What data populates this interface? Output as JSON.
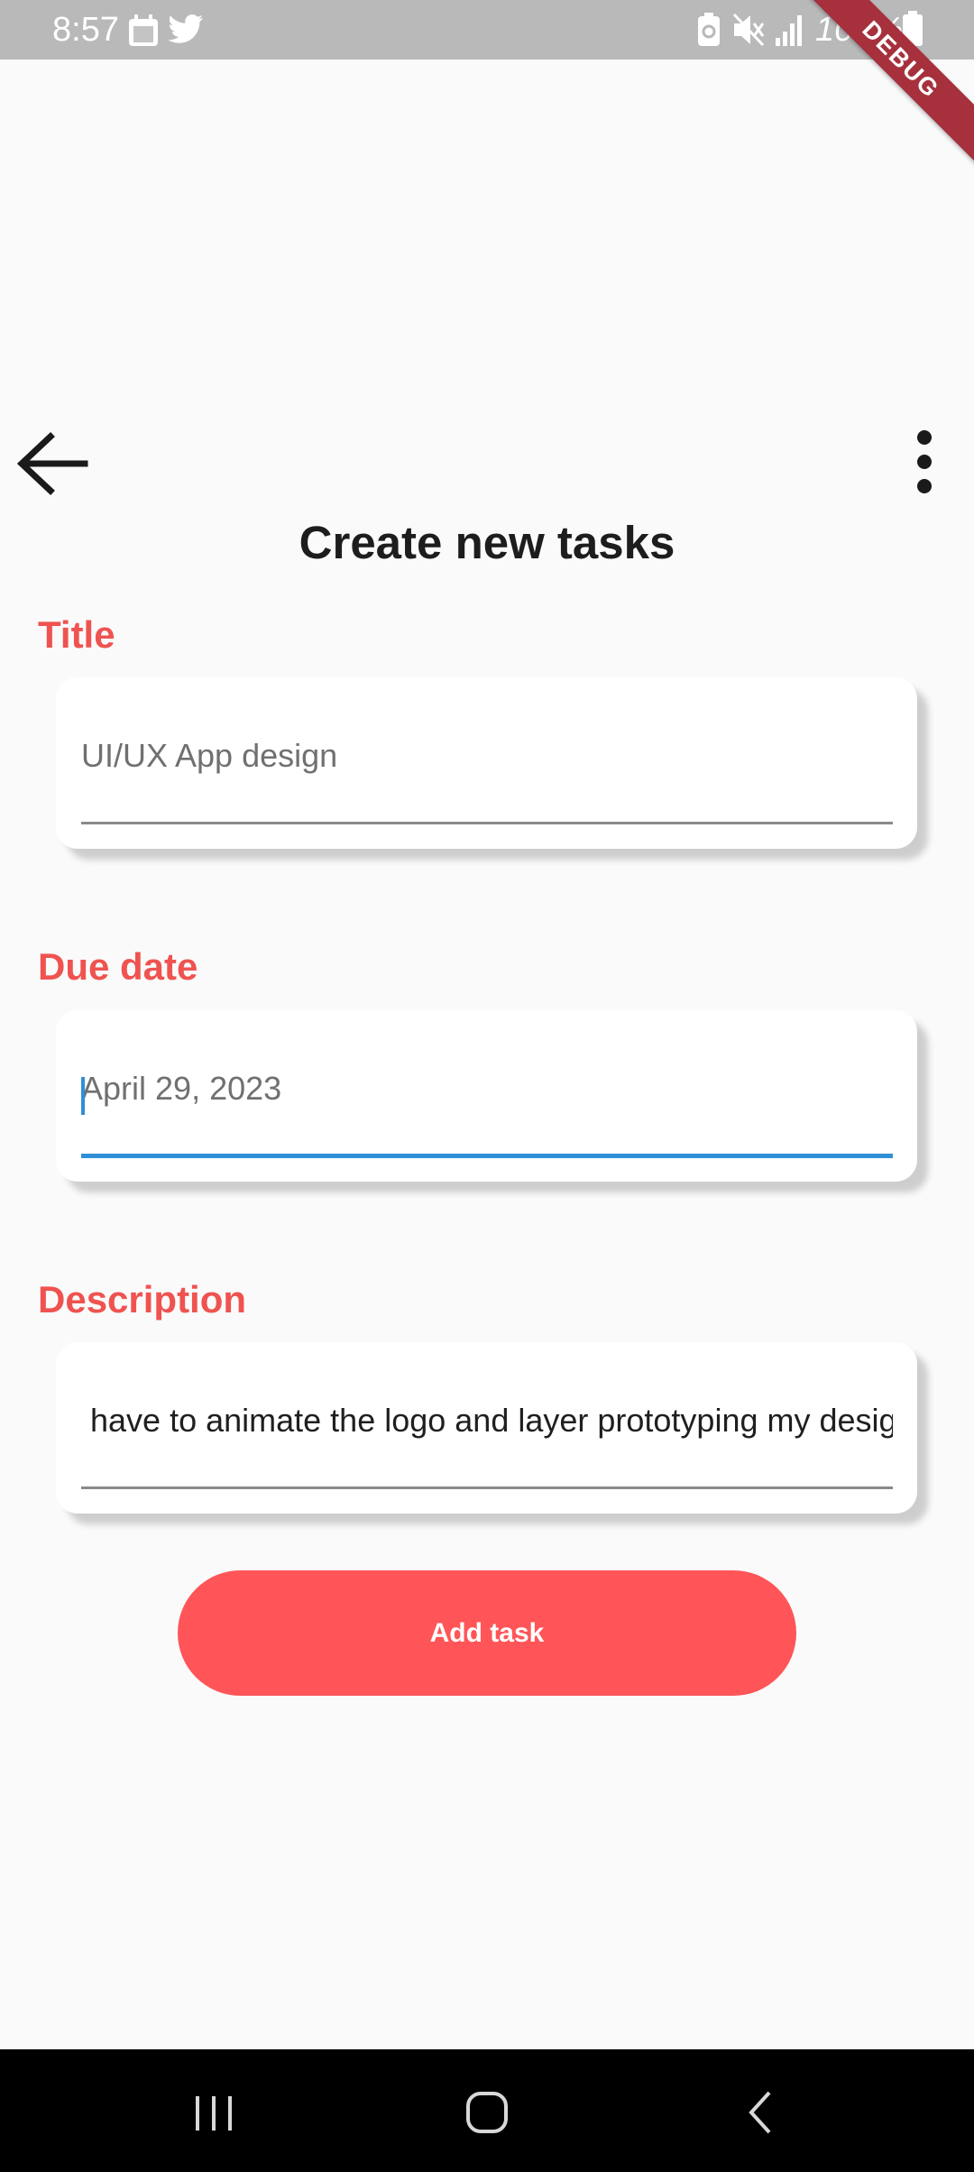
{
  "status_bar": {
    "time": "8:57",
    "battery_percent": "100%",
    "icons": [
      "calendar-icon",
      "twitter-icon",
      "battery-saver-icon",
      "mute-icon",
      "signal-icon",
      "battery-icon"
    ]
  },
  "debug_banner": "DEBUG",
  "app_bar": {
    "back_icon": "arrow-back-icon",
    "more_icon": "more-vert-icon"
  },
  "page_title": "Create new tasks",
  "form": {
    "title": {
      "label": "Title",
      "placeholder": "UI/UX App design",
      "value": ""
    },
    "due_date": {
      "label": "Due date",
      "placeholder": "April 29, 2023",
      "value": "",
      "focused": true
    },
    "description": {
      "label": "Description",
      "placeholder": "",
      "value": "have to animate the logo and layer prototyping my desig"
    }
  },
  "add_task_label": "Add task",
  "nav_bar": {
    "icons": [
      "recent-apps-icon",
      "home-icon",
      "back-nav-icon"
    ]
  },
  "colors": {
    "accent": "#ef5350",
    "button": "#ff5558",
    "focus": "#2f8fd8",
    "background": "#fafafa",
    "status_bar": "#b9b9b9",
    "debug_ribbon": "#a6313d"
  }
}
